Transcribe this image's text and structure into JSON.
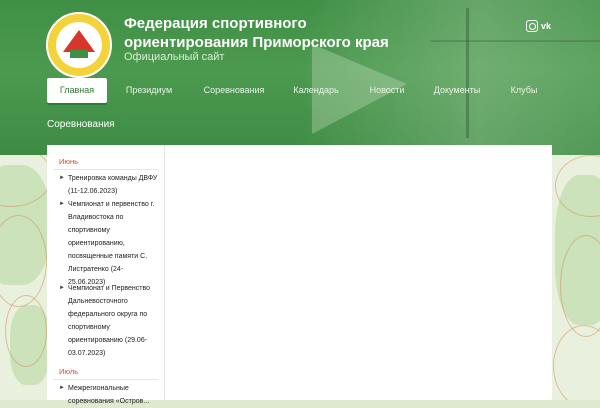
{
  "site": {
    "title": "Федерация спортивного ориентирования Приморского края",
    "subtitle": "Официальный сайт"
  },
  "social": [
    {
      "name": "instagram-icon",
      "label": ""
    },
    {
      "name": "vk-icon",
      "label": "vk"
    }
  ],
  "nav": {
    "items": [
      {
        "label": "Главная",
        "active": true
      },
      {
        "label": "Президиум"
      },
      {
        "label": "Соревнования"
      },
      {
        "label": "Календарь"
      },
      {
        "label": "Новости"
      },
      {
        "label": "Документы"
      },
      {
        "label": "Клубы"
      }
    ]
  },
  "breadcrumb": "Соревнования",
  "sidebar": {
    "months": [
      {
        "label": "Июнь",
        "events": [
          "Тренировка команды ДВФУ (11-12.06.2023)",
          "Чемпионат и первенство г. Владивостока по спортивному ориентированию, посвященные памяти С. Листратенко (24-25.06.2023)",
          "Чемпионат и Первенство Дальневосточного федерального округа по спортивному ориентированию (29.06-03.07.2023)"
        ]
      },
      {
        "label": "Июль",
        "events": [
          "Межрегиональные соревнования «Остров..."
        ]
      }
    ]
  }
}
